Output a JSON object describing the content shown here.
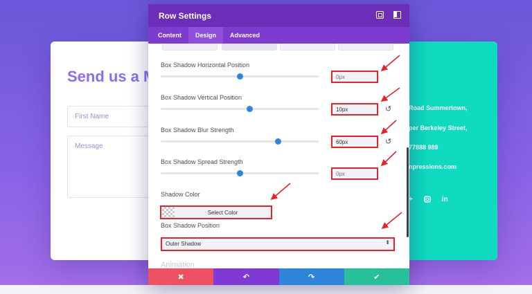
{
  "background": {
    "contact_title": "Send us a M",
    "first_name_placeholder": "First Name",
    "message_placeholder": "Message",
    "contact_lines": [
      "Road Summertown,",
      "per Berkeley Street,",
      "77888 989",
      "npressions.com"
    ],
    "social_icons": [
      "+",
      "instagram-icon",
      "in"
    ]
  },
  "modal": {
    "title": "Row Settings",
    "tabs": [
      {
        "label": "Content",
        "active": false
      },
      {
        "label": "Design",
        "active": true
      },
      {
        "label": "Advanced",
        "active": false
      }
    ],
    "options": [
      {
        "label": "Box Shadow Horizontal Position",
        "slider_level": 0.5,
        "value": "",
        "placeholder": "0px"
      },
      {
        "label": "Box Shadow Vertical Position",
        "slider_level": 0.56,
        "value": "10px",
        "placeholder": ""
      },
      {
        "label": "Box Shadow Blur Strength",
        "slider_level": 0.74,
        "value": "60px",
        "placeholder": ""
      },
      {
        "label": "Box Shadow Spread Strength",
        "slider_level": 0.5,
        "value": "",
        "placeholder": "0px"
      }
    ],
    "shadow_color": {
      "label": "Shadow Color",
      "button": "Select Color"
    },
    "shadow_position": {
      "label": "Box Shadow Position",
      "selected": "Outer Shadow"
    },
    "next_section": "Animation",
    "footer": {
      "cancel_icon": "✖",
      "undo_icon": "↶",
      "redo_icon": "↷",
      "save_icon": "✔"
    }
  },
  "colors": {
    "header": "#6c2eb9",
    "tabs": "#7e3bd0",
    "highlight_red": "#e8222a",
    "slider_knob": "#2b87da",
    "teal": "#0fdbc0"
  }
}
